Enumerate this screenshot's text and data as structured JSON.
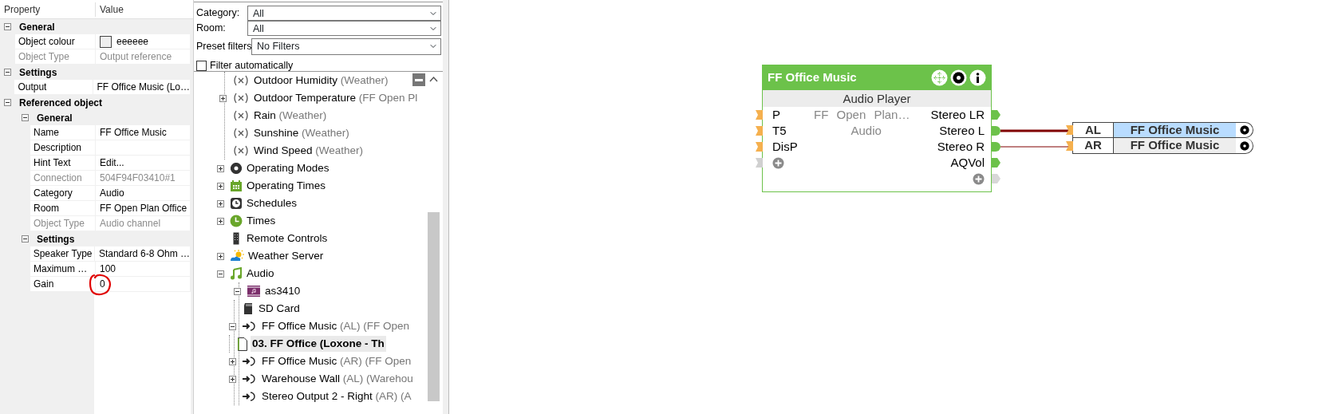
{
  "properties": {
    "columns": [
      "Property",
      "Value"
    ],
    "items": [
      {
        "kind": "category",
        "label": "General",
        "expanded": true,
        "items": [
          {
            "kind": "property",
            "name": "Object colour",
            "value": "eeeeee",
            "color": "#eeeeee",
            "disabled": false,
            "circled": false
          },
          {
            "kind": "property",
            "name": "Object Type",
            "value": "Output reference",
            "disabled": true,
            "circled": false
          }
        ]
      },
      {
        "kind": "category",
        "label": "Settings",
        "expanded": true,
        "items": [
          {
            "kind": "property",
            "name": "Output",
            "value": "FF Office Music (Lo…",
            "disabled": false,
            "circled": false
          }
        ]
      },
      {
        "kind": "category",
        "label": "Referenced object",
        "expanded": true,
        "items": [
          {
            "kind": "category",
            "label": "General",
            "expanded": true,
            "items": [
              {
                "kind": "property",
                "name": "Name",
                "value": "FF Office Music",
                "disabled": false,
                "circled": false
              },
              {
                "kind": "property",
                "name": "Description",
                "disabled": false,
                "circled": false
              },
              {
                "kind": "property",
                "name": "Hint Text",
                "value": "Edit...",
                "disabled": false,
                "circled": false
              },
              {
                "kind": "property",
                "name": "Connection",
                "value": "504F94F03410#1",
                "disabled": true,
                "circled": false
              },
              {
                "kind": "property",
                "name": "Category",
                "value": "Audio",
                "disabled": false,
                "circled": false
              },
              {
                "kind": "property",
                "name": "Room",
                "value": "FF Open Plan Office",
                "disabled": false,
                "circled": false
              },
              {
                "kind": "property",
                "name": "Object Type",
                "value": "Audio channel",
                "disabled": true,
                "circled": false
              }
            ]
          },
          {
            "kind": "category",
            "label": "Settings",
            "expanded": true,
            "items": [
              {
                "kind": "property",
                "name": "Speaker Type",
                "value": "Standard 6-8 Ohm …",
                "disabled": false,
                "circled": false
              },
              {
                "kind": "property",
                "name": "Maximum …",
                "value": "100",
                "disabled": false,
                "circled": false
              },
              {
                "kind": "property",
                "name": "Gain",
                "value": "0",
                "disabled": false,
                "circled": true
              }
            ]
          }
        ]
      }
    ]
  },
  "filters": {
    "category": {
      "label": "Category:",
      "value": "All"
    },
    "room": {
      "label": "Room:",
      "value": "All"
    },
    "preset": {
      "label": "Preset filters",
      "value": "No Filters"
    },
    "auto_filter": {
      "label": "Filter automatically",
      "checked": false
    }
  },
  "tree": [
    {
      "children": [
        {
          "kind": "variable",
          "label": "Outdoor Humidity",
          "detail": "(Weather)",
          "selected": false
        },
        {
          "kind": "variable",
          "label": "Outdoor Temperature",
          "detail": "(FF Open Pl",
          "expanded": false,
          "selected": false
        },
        {
          "kind": "variable",
          "label": "Rain",
          "detail": "(Weather)",
          "selected": false
        },
        {
          "kind": "variable",
          "label": "Sunshine",
          "detail": "(Weather)",
          "selected": false
        },
        {
          "kind": "variable",
          "label": "Wind Speed",
          "detail": "(Weather)",
          "selected": false
        }
      ]
    },
    {
      "kind": "mode",
      "label": "Operating Modes",
      "expanded": false,
      "selected": false
    },
    {
      "kind": "schedule",
      "label": "Operating Times",
      "expanded": false,
      "selected": false
    },
    {
      "kind": "timer",
      "label": "Schedules",
      "expanded": false,
      "selected": false
    },
    {
      "kind": "time",
      "label": "Times",
      "expanded": false,
      "selected": false
    },
    {
      "kind": "remote",
      "label": "Remote Controls",
      "selected": false
    },
    {
      "kind": "weather",
      "label": "Weather Server",
      "expanded": false,
      "selected": false
    },
    {
      "kind": "audio",
      "label": "Audio",
      "expanded": true,
      "selected": false,
      "children": [
        {
          "kind": "device",
          "label": "as3410",
          "expanded": true,
          "selected": false,
          "children": [
            {
              "kind": "storage",
              "label": "SD Card",
              "selected": false
            },
            {
              "kind": "output",
              "label": "FF Office Music",
              "detail": "(AL) (FF Open",
              "expanded": true,
              "selected": false,
              "children": [
                {
                  "kind": "file",
                  "label": "03. FF Office (Loxone - Th",
                  "selected": true
                }
              ]
            },
            {
              "kind": "output",
              "label": "FF Office Music",
              "detail": "(AR) (FF Open",
              "expanded": false,
              "selected": false
            },
            {
              "kind": "output",
              "label": "Warehouse Wall",
              "detail": "(AL) (Warehou",
              "expanded": false,
              "selected": false
            },
            {
              "kind": "output",
              "label": "Stereo Output 2 - Right",
              "detail": "(AR) (A",
              "selected": false
            }
          ]
        }
      ]
    }
  ],
  "diagram": {
    "block": {
      "title": "FF Office Music",
      "subtitle": "Audio Player",
      "inputs": [
        "P",
        "T5",
        "DisP"
      ],
      "info": [
        "FF Open Plan…",
        "Audio"
      ],
      "outputs": [
        {
          "label": "Stereo LR",
          "wired": false
        },
        {
          "label": "Stereo L",
          "wired": true
        },
        {
          "label": "Stereo R",
          "wired": true
        },
        {
          "label": "AQVol",
          "wired": false
        }
      ]
    },
    "references": [
      {
        "channel": "AL",
        "name": "FF Office Music",
        "selected": true,
        "kind": "thick"
      },
      {
        "channel": "AR",
        "name": "FF Office Music",
        "selected": false,
        "kind": "thin"
      }
    ]
  }
}
